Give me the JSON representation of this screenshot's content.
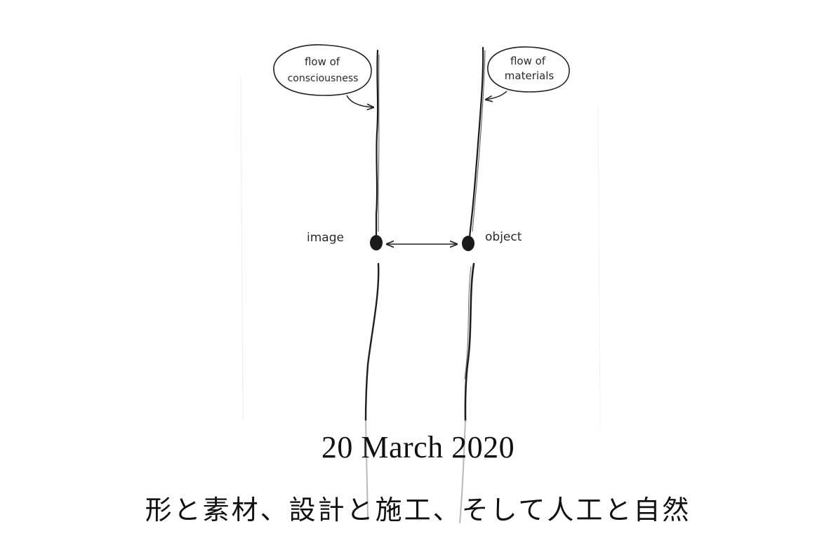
{
  "diagram": {
    "left_bubble": [
      "flow of",
      "consciousness"
    ],
    "right_bubble": [
      "flow of",
      "materials"
    ],
    "left_node": "image",
    "right_node": "object"
  },
  "caption": {
    "date": "20 March 2020",
    "title": "形と素材、設計と施工、そして人工と自然"
  }
}
